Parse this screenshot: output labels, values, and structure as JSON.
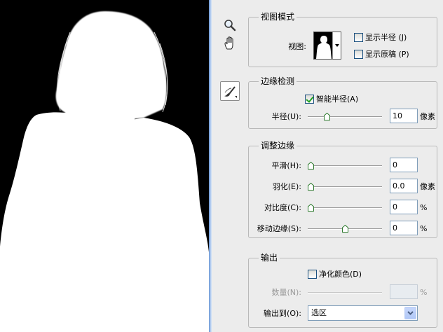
{
  "view_mode": {
    "legend": "视图模式",
    "view_label": "视图:",
    "show_radius": "显示半径 (J)",
    "show_original": "显示原稿 (P)",
    "show_radius_checked": false,
    "show_original_checked": false
  },
  "edge_detection": {
    "legend": "边缘检测",
    "smart_radius": "智能半径(A)",
    "smart_radius_checked": true,
    "radius_label": "半径(U):",
    "radius_value": "10",
    "radius_unit": "像素",
    "radius_slider": 0.25
  },
  "adjust_edge": {
    "legend": "调整边缘",
    "smooth_label": "平滑(H):",
    "smooth_value": "0",
    "smooth_slider": 0,
    "feather_label": "羽化(E):",
    "feather_value": "0.0",
    "feather_unit": "像素",
    "feather_slider": 0,
    "contrast_label": "对比度(C):",
    "contrast_value": "0",
    "contrast_unit": "%",
    "contrast_slider": 0,
    "shift_label": "移动边缘(S):",
    "shift_value": "0",
    "shift_unit": "%",
    "shift_slider": 0.5
  },
  "output": {
    "legend": "输出",
    "decontaminate": "净化颜色(D)",
    "decontaminate_checked": false,
    "amount_label": "数量(N):",
    "amount_value": "",
    "amount_unit": "%",
    "output_to_label": "输出到(O):",
    "output_to_value": "选区"
  },
  "icons": {
    "zoom": "magnifier-icon",
    "hand": "hand-icon",
    "refine": "refine-brush-icon"
  }
}
